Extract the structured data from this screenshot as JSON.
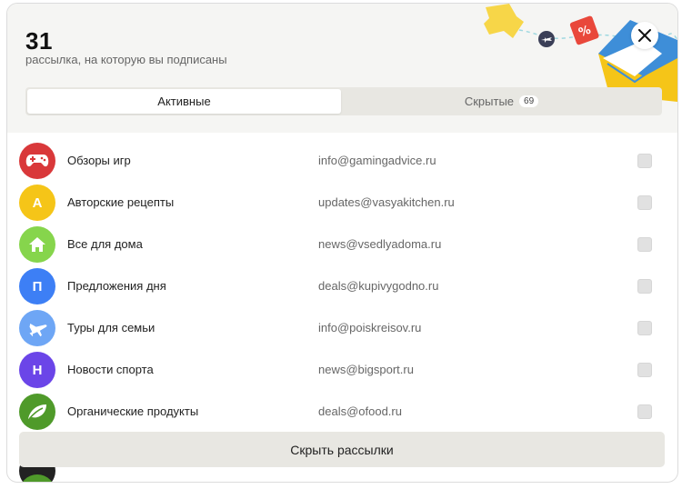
{
  "header": {
    "count": "31",
    "subtitle": "рассылка, на которую вы подписаны",
    "close_icon": "close-icon"
  },
  "tabs": [
    {
      "label": "Активные",
      "active": true
    },
    {
      "label": "Скрытые",
      "count": "69",
      "active": false
    }
  ],
  "subscriptions": [
    {
      "name": "Обзоры игр",
      "email": "info@gamingadvice.ru",
      "avatar_color": "#d9383a",
      "icon": "gamepad-icon",
      "checked": false
    },
    {
      "name": "Авторские рецепты",
      "email": "updates@vasyakitchen.ru",
      "avatar_color": "#f5c518",
      "avatar_letter": "А",
      "checked": false
    },
    {
      "name": "Все для дома",
      "email": "news@vsedlyadoma.ru",
      "avatar_color": "#86d54c",
      "icon": "house-icon",
      "checked": false
    },
    {
      "name": "Предложения дня",
      "email": "deals@kupivygodno.ru",
      "avatar_color": "#3d7ff5",
      "avatar_letter": "П",
      "checked": false
    },
    {
      "name": "Туры для семьи",
      "email": "info@poiskreisov.ru",
      "avatar_color": "#6ea6f5",
      "icon": "airplane-icon",
      "checked": false
    },
    {
      "name": "Новости спорта",
      "email": "news@bigsport.ru",
      "avatar_color": "#6b45e8",
      "avatar_letter": "Н",
      "checked": false
    },
    {
      "name": "Органические продукты",
      "email": "deals@ofood.ru",
      "avatar_color": "#4f9a2a",
      "icon": "leaf-icon",
      "checked": false
    }
  ],
  "footer": {
    "hide_button": "Скрыть рассылки"
  },
  "colors": {
    "header_bg": "#f5f5f3",
    "tab_bg": "#e8e7e2",
    "button_bg": "#e8e7e2"
  }
}
